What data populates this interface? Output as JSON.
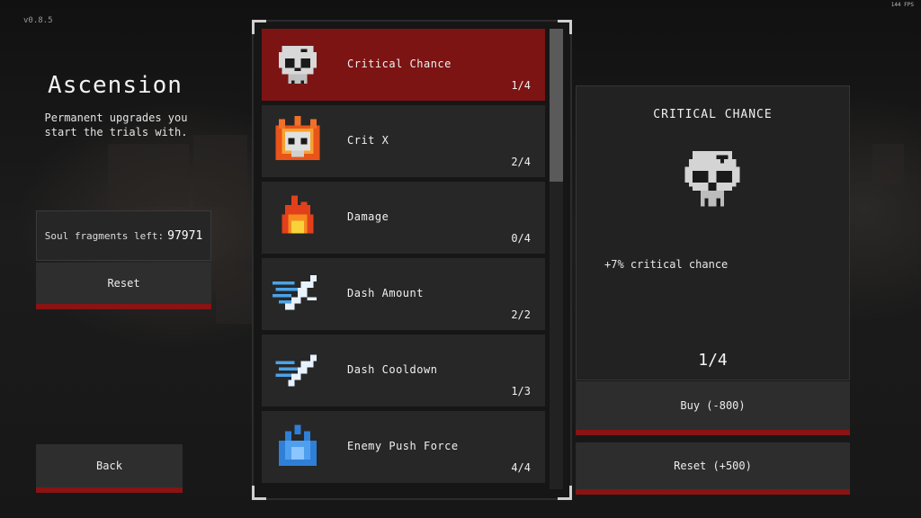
{
  "version": "v0.8.5",
  "fps": "144 FPS",
  "left_panel": {
    "title": "Ascension",
    "description": "Permanent upgrades you start the trials with.",
    "soul_label": "Soul fragments left:",
    "soul_value": "97971",
    "reset_label": "Reset",
    "back_label": "Back"
  },
  "upgrades": [
    {
      "name": "Critical Chance",
      "level": "1/4",
      "icon": "skull-icon",
      "selected": true
    },
    {
      "name": "Crit X",
      "level": "2/4",
      "icon": "flaming-skull-icon",
      "selected": false
    },
    {
      "name": "Damage",
      "level": "0/4",
      "icon": "fire-icon",
      "selected": false
    },
    {
      "name": "Dash Amount",
      "level": "2/2",
      "icon": "dash-runner-icon",
      "selected": false
    },
    {
      "name": "Dash Cooldown",
      "level": "1/3",
      "icon": "dash-runner-small-icon",
      "selected": false
    },
    {
      "name": "Enemy Push Force",
      "level": "4/4",
      "icon": "blue-burst-icon",
      "selected": false
    }
  ],
  "detail": {
    "title": "CRITICAL CHANCE",
    "description": "+7% critical chance",
    "level": "1/4",
    "buy_label": "Buy (-800)",
    "reset_label": "Reset (+500)"
  },
  "colors": {
    "accent": "#8a1313",
    "selected_row": "#7c1414",
    "panel": "#272727"
  }
}
